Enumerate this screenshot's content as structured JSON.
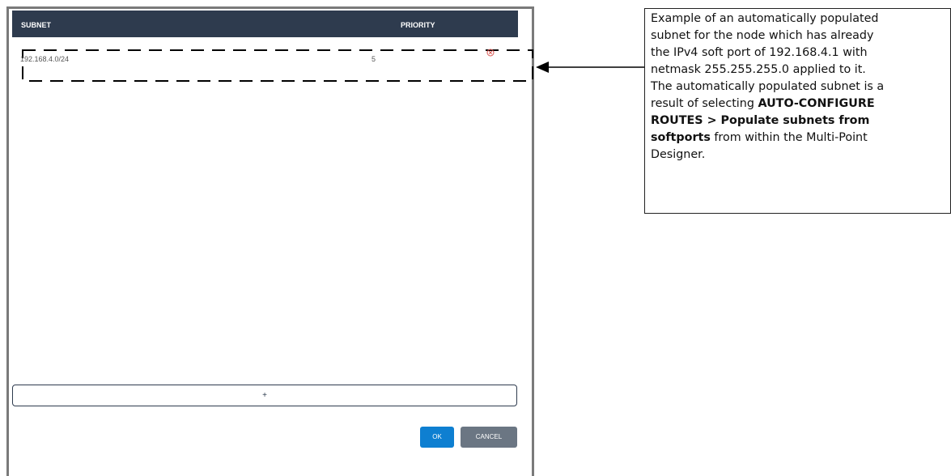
{
  "table": {
    "columns": {
      "subnet": "SUBNET",
      "priority": "PRIORITY"
    },
    "rows": [
      {
        "subnet": "192.168.4.0/24",
        "priority": "5"
      }
    ]
  },
  "actions": {
    "add_label": "+",
    "ok_label": "OK",
    "cancel_label": "CANCEL"
  },
  "icons": {
    "remove": "remove-circle-icon"
  },
  "colors": {
    "header_bg": "#2e3b4e",
    "ok_bg": "#0e7fd1",
    "cancel_bg": "#6b7683",
    "remove_icon": "#d9534f"
  },
  "callout": {
    "lines": [
      {
        "text": "Example of an automatically populated"
      },
      {
        "text": "subnet for the node which has already"
      },
      {
        "text": "the IPv4 soft port of 192.168.4.1 with"
      },
      {
        "text": "netmask 255.255.255.0 applied to it."
      },
      {
        "text": "The automatically populated subnet is a"
      },
      {
        "pre": "result of selecting ",
        "bold": "AUTO-CONFIGURE"
      },
      {
        "bold": "ROUTES > Populate subnets from"
      },
      {
        "bold": "softports",
        "post": " from within the Multi-Point"
      },
      {
        "text": "Designer."
      }
    ]
  }
}
